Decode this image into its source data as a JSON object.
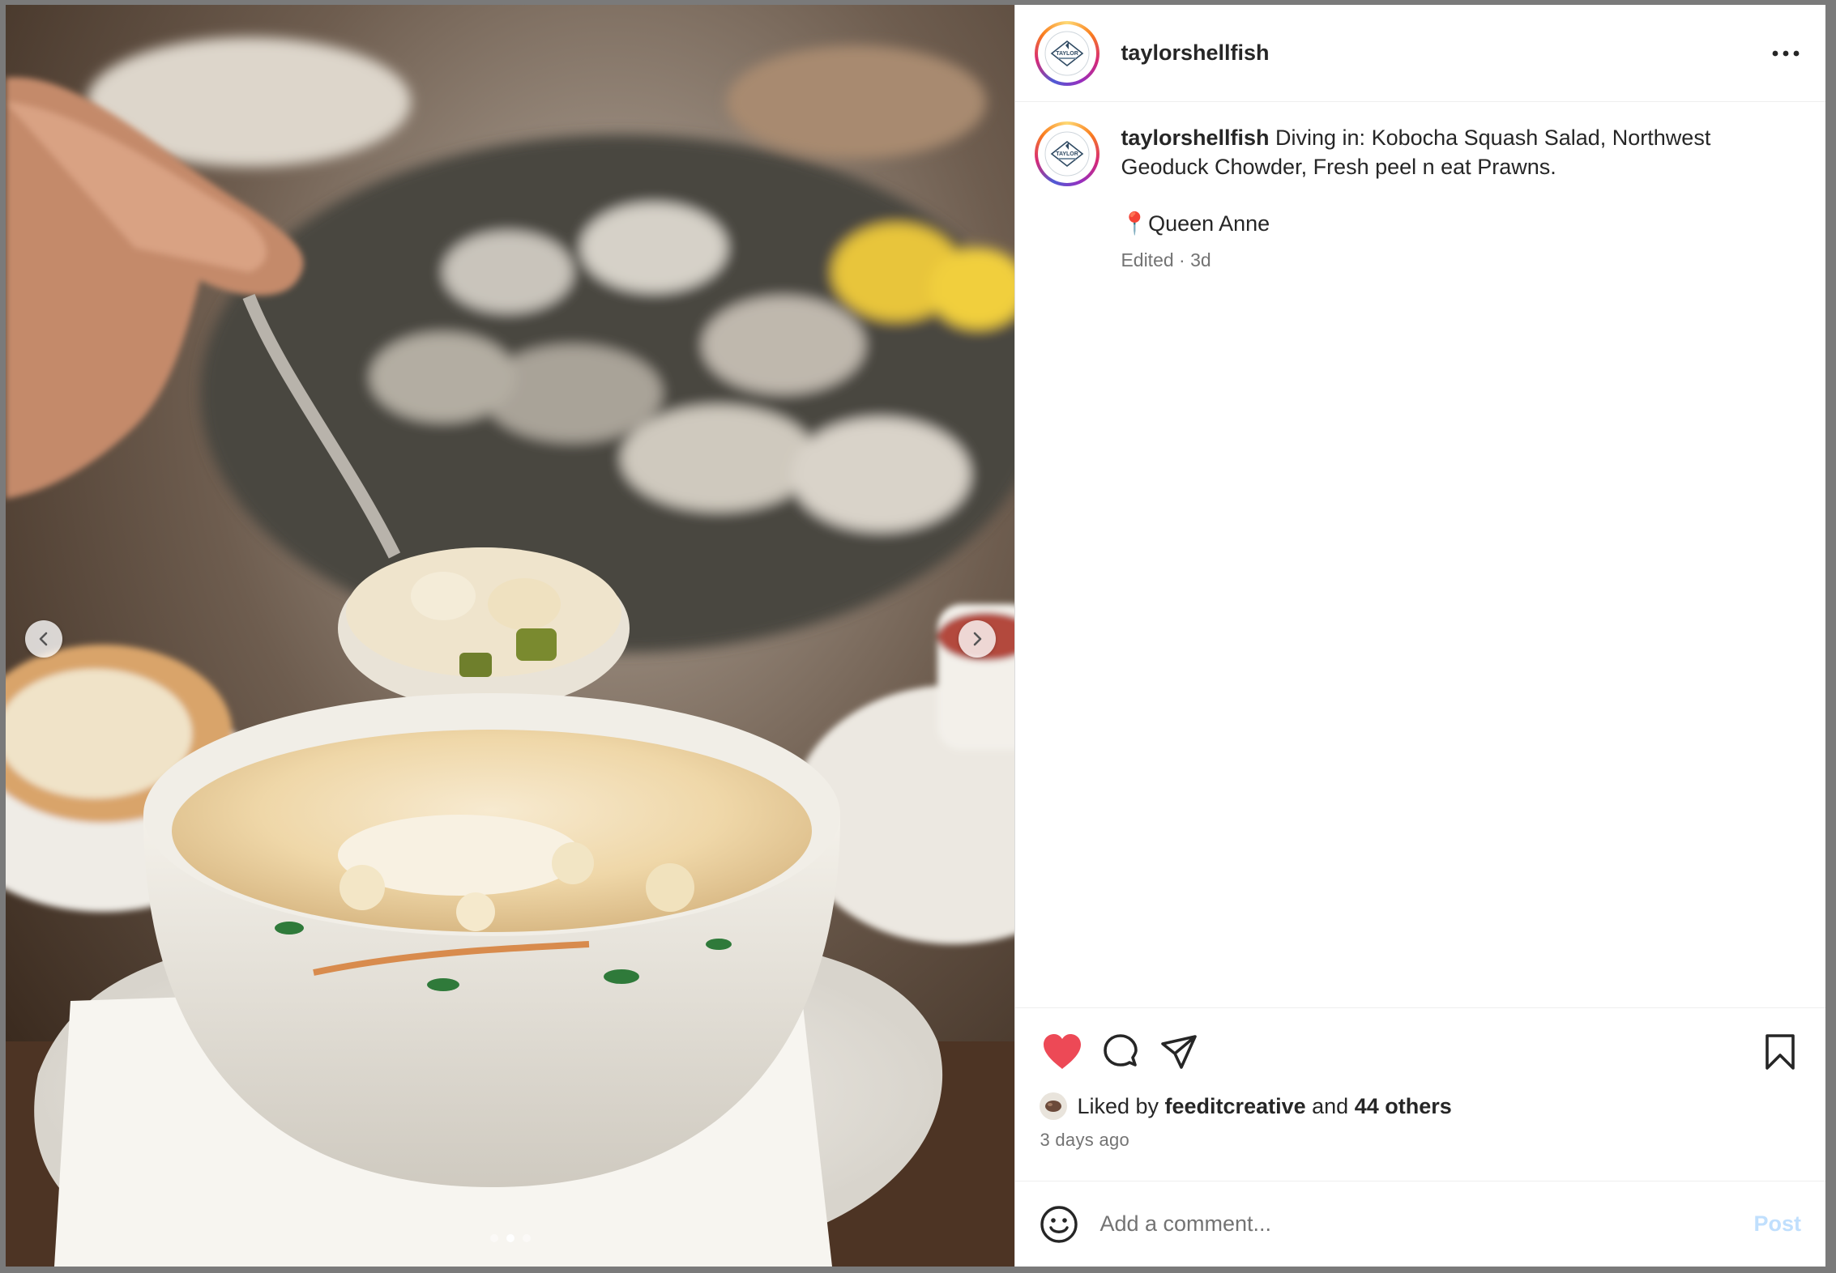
{
  "post": {
    "username": "taylorshellfish",
    "logo_text": "TAYLOR",
    "caption": "Diving in: Kobocha Squash Salad, Northwest Geoduck Chowder, Fresh peel n eat Prawns.",
    "location_pin": "📍",
    "location": "Queen Anne",
    "edited_meta": "Edited · 3d",
    "liked_prefix": "Liked by",
    "liked_user": "feeditcreative",
    "liked_and": "and",
    "liked_others": "44 others",
    "time_ago": "3 days ago",
    "carousel": {
      "total": 3,
      "active_index": 1
    }
  },
  "comment": {
    "placeholder": "Add a comment...",
    "post_label": "Post"
  },
  "colors": {
    "like_red": "#ed4956",
    "post_disabled": "#c0dffd",
    "meta_gray": "#737373"
  },
  "icons": {
    "more": "more-horizontal-icon",
    "like": "heart-filled-icon",
    "comment": "comment-bubble-icon",
    "share": "paper-plane-icon",
    "save": "bookmark-icon",
    "emoji": "smiley-icon",
    "prev": "chevron-left-icon",
    "next": "chevron-right-icon"
  }
}
